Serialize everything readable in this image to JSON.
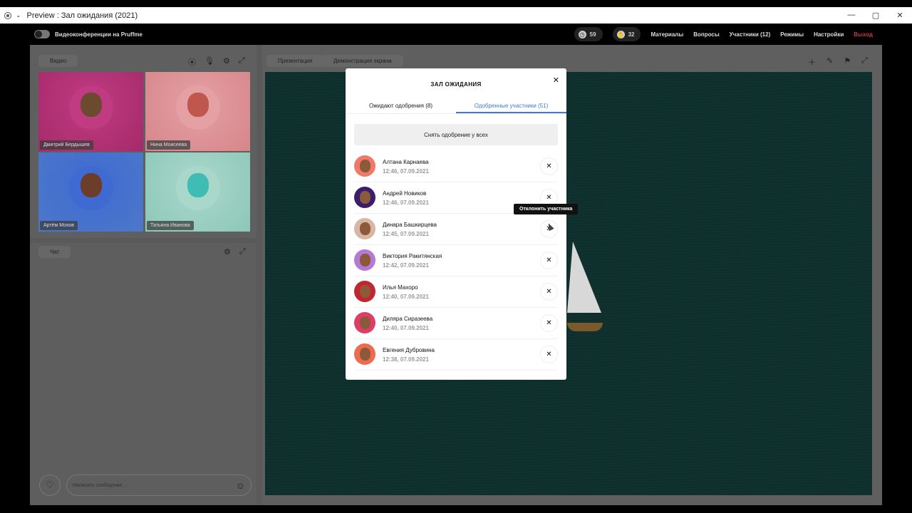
{
  "window": {
    "title": "Preview : Зал ожидания (2021)",
    "controls": [
      "—",
      "▢",
      "✕"
    ]
  },
  "appbar": {
    "brand": "Видеоконференции на Pruffme",
    "clock_count": "59",
    "hand_count": "32",
    "nav": [
      "Материалы",
      "Вопросы",
      "Участники (12)",
      "Режимы",
      "Настройки"
    ],
    "exit": "Выход",
    "exit_color": "#c9364d"
  },
  "video_panel": {
    "tab": "Видео",
    "tiles": [
      {
        "name": "Дмитрий Бердышев",
        "bg": "#a52a6a",
        "ring": "#c03b82",
        "face": "#6b4a30"
      },
      {
        "name": "Нина Моисеева",
        "bg": "#d6868a",
        "ring": "#e4a0a3",
        "face": "#c0574e"
      },
      {
        "name": "Артём Мохов",
        "bg": "#4d78c8",
        "ring": "#3f6ad2",
        "face": "#6b3d2a"
      },
      {
        "name": "Татьяна Иванова",
        "bg": "#8cc7b8",
        "ring": "#a9d8cb",
        "face": "#3fbcb3"
      }
    ]
  },
  "chat_panel": {
    "tab": "Чат",
    "placeholder": "Написать сообщение..."
  },
  "presentation_panel": {
    "tabs": [
      "Презентация",
      "Демонстрация экрана"
    ]
  },
  "modal": {
    "title": "ЗАЛ ОЖИДАНИЯ",
    "tabs": [
      {
        "label": "Ожидают одобрения (8)",
        "active": false
      },
      {
        "label": "Одобренные участники (51)",
        "active": true
      }
    ],
    "revoke_all": "Снять одобрение у всех",
    "tooltip": "Отклонить участника",
    "accent": "#3a7bd5",
    "participants": [
      {
        "name": "Алтана Карнаева",
        "time": "12:46, 07.09.2021",
        "bg": "#f07a6a"
      },
      {
        "name": "Андрей Новиков",
        "time": "12:46, 07.09.2021",
        "bg": "#3a1d6b"
      },
      {
        "name": "Динара Башкирцева",
        "time": "12:45, 07.09.2021",
        "bg": "#d9b6a4"
      },
      {
        "name": "Виктория Ракитянская",
        "time": "12:42, 07.09.2021",
        "bg": "#b57ad6"
      },
      {
        "name": "Илья Махоро",
        "time": "12:40, 07.09.2021",
        "bg": "#c4262f"
      },
      {
        "name": "Диляра Сиразеева",
        "time": "12:40, 07.09.2021",
        "bg": "#e03c66"
      },
      {
        "name": "Евгения Дубровина",
        "time": "12:38, 07.09.2021",
        "bg": "#ef6b4e"
      }
    ]
  }
}
